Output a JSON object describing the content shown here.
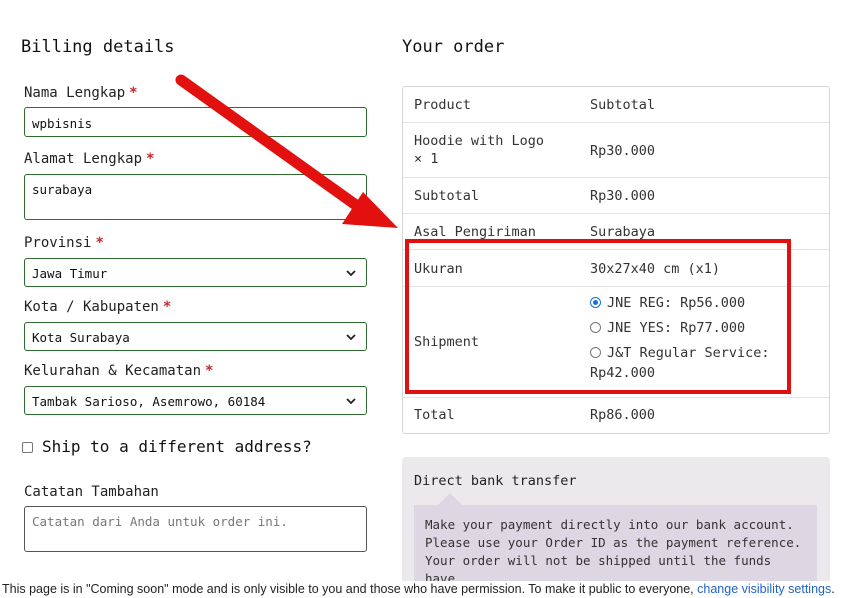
{
  "billing": {
    "title": "Billing details",
    "required_mark": "*",
    "fields": [
      {
        "label": "Nama Lengkap",
        "value": "wpbisnis"
      },
      {
        "label": "Alamat Lengkap",
        "value": "surabaya"
      },
      {
        "label": "Provinsi",
        "value": "Jawa Timur"
      },
      {
        "label": "Kota / Kabupaten",
        "value": "Kota Surabaya"
      },
      {
        "label": "Kelurahan & Kecamatan",
        "value": "Tambak Sarioso, Asemrowo, 60184"
      }
    ],
    "ship_different_label": "Ship to a different address?",
    "notes_label": "Catatan Tambahan",
    "notes_placeholder": "Catatan dari Anda untuk order ini."
  },
  "order": {
    "title": "Your order",
    "header": {
      "product": "Product",
      "subtotal": "Subtotal"
    },
    "item": {
      "name_line1": "Hoodie with Logo",
      "name_line2": "× 1",
      "price": "Rp30.000"
    },
    "subtotal": {
      "label": "Subtotal",
      "value": "Rp30.000"
    },
    "origin": {
      "label": "Asal Pengiriman",
      "value": "Surabaya"
    },
    "size": {
      "label": "Ukuran",
      "value": "30x27x40 cm (x1)"
    },
    "shipment": {
      "label": "Shipment",
      "options": [
        {
          "line1": "JNE REG: Rp56.000",
          "line2": "",
          "selected": true
        },
        {
          "line1": "JNE YES: Rp77.000",
          "line2": "",
          "selected": false
        },
        {
          "line1": "J&T Regular Service:",
          "line2": "Rp42.000",
          "selected": false
        }
      ]
    },
    "total": {
      "label": "Total",
      "value": "Rp86.000"
    }
  },
  "payment": {
    "method_title": "Direct bank transfer",
    "description_lines": [
      "Make your payment directly into our bank account.",
      "Please use your Order ID as the payment reference.",
      "Your order will not be shipped until the funds have"
    ]
  },
  "notice": {
    "text": "This page is in \"Coming soon\" mode and is only visible to you and those who have permission. To make it public to everyone, ",
    "link": "change visibility settings",
    "suffix": "."
  },
  "colors": {
    "highlight": "#e01010",
    "field_border": "#2e6b2e",
    "link": "#2263c4",
    "required": "#c62828"
  },
  "icons": [
    "chevron-down-icon",
    "red-arrow-annotation"
  ]
}
